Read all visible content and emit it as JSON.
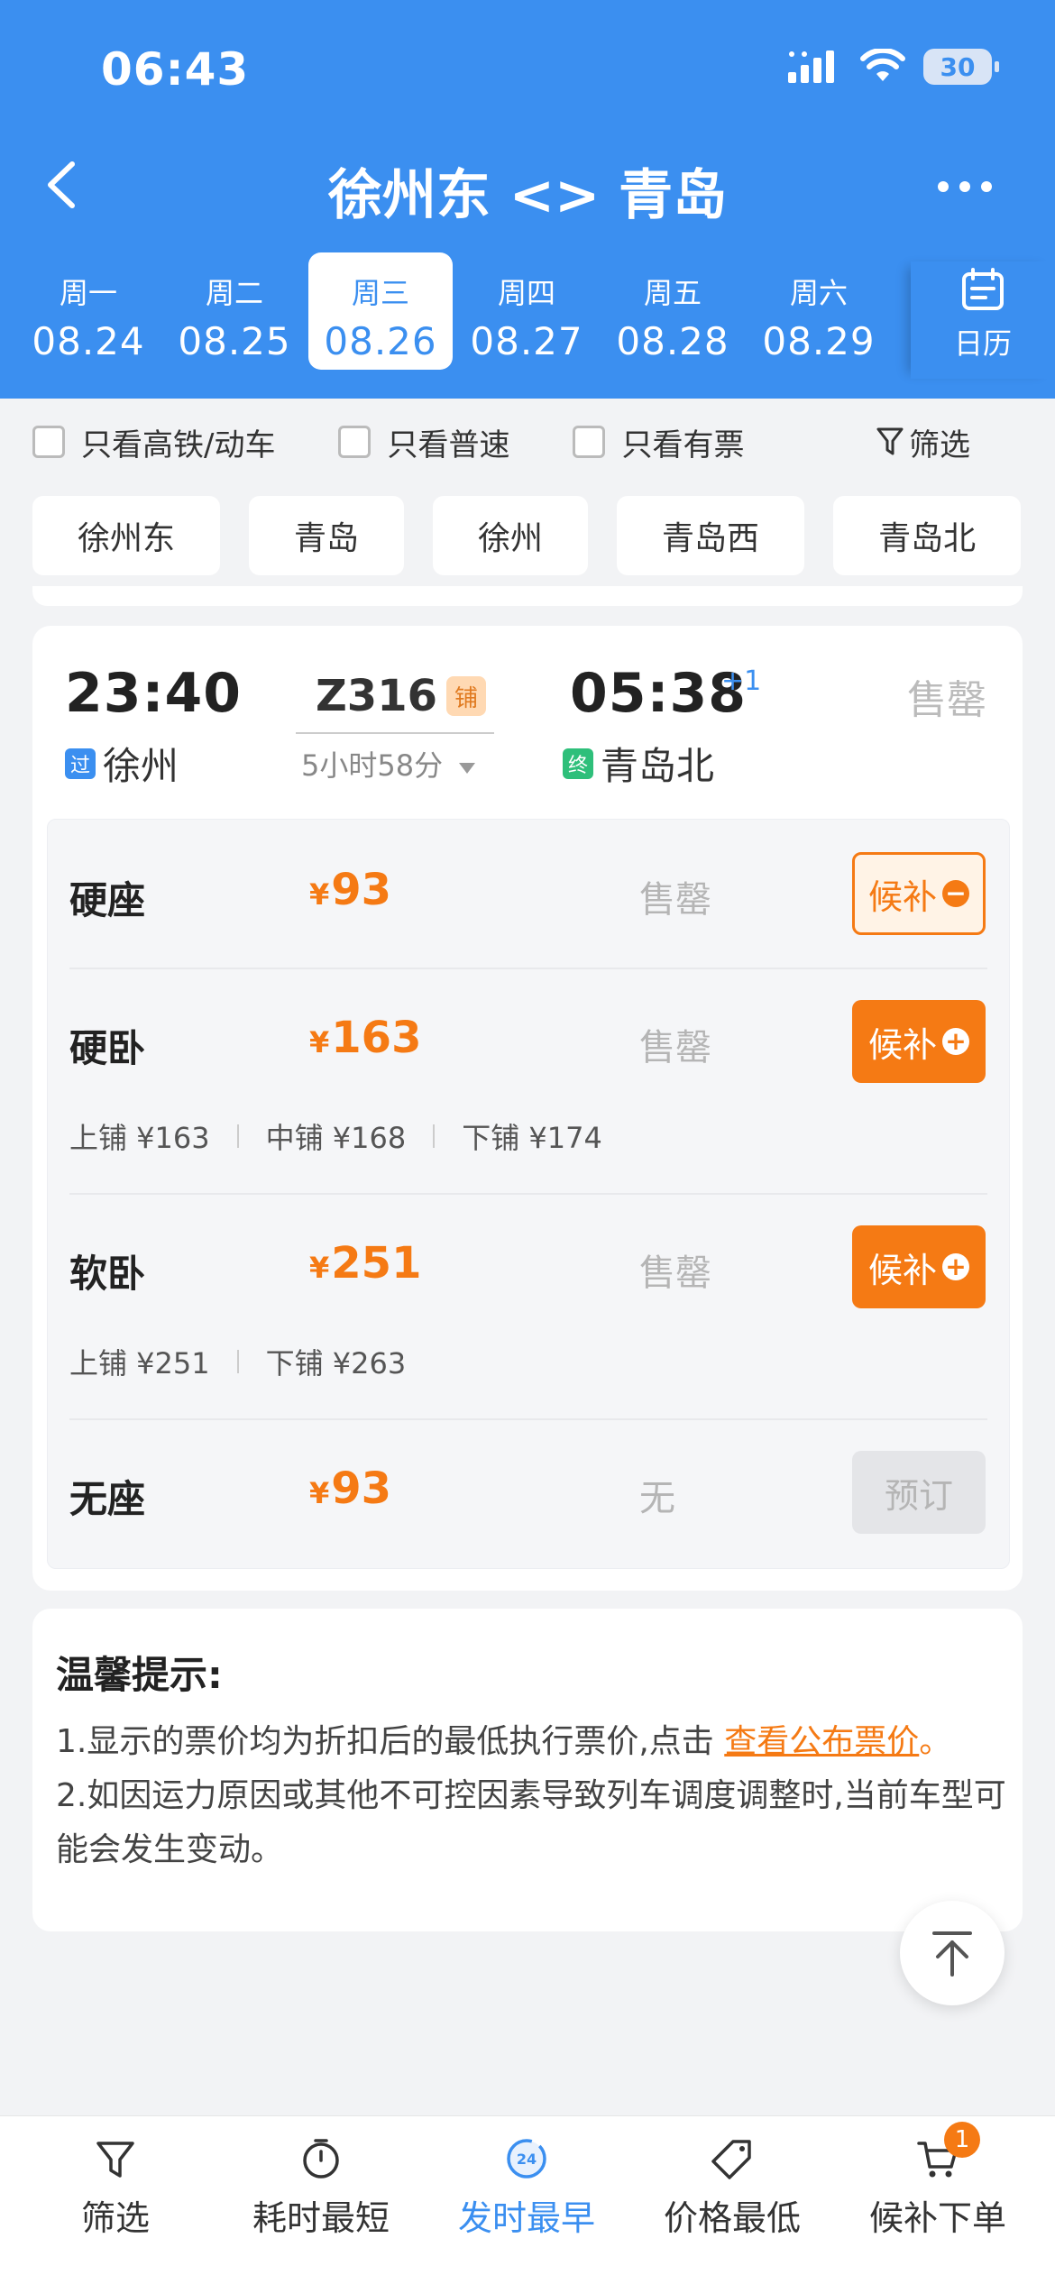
{
  "status_bar": {
    "time": "06:43",
    "battery": "30"
  },
  "header": {
    "title": "徐州东 <> 青岛",
    "date_tabs": [
      {
        "weekday": "周一",
        "date": "08.24"
      },
      {
        "weekday": "周二",
        "date": "08.25"
      },
      {
        "weekday": "周三",
        "date": "08.26"
      },
      {
        "weekday": "周四",
        "date": "08.27"
      },
      {
        "weekday": "周五",
        "date": "08.28"
      },
      {
        "weekday": "周六",
        "date": "08.29"
      }
    ],
    "active_tab_index": 2,
    "calendar_label": "日历"
  },
  "filters": {
    "high_speed": "只看高铁/动车",
    "normal": "只看普速",
    "available": "只看有票",
    "filter": "筛选"
  },
  "stations": [
    "徐州东",
    "青岛",
    "徐州",
    "青岛西",
    "青岛北"
  ],
  "train": {
    "dep_time": "23:40",
    "dep_tag": "过",
    "dep_station": "徐州",
    "train_no": "Z316",
    "berth_tag": "铺",
    "duration": "5小时58分",
    "arr_time": "05:38",
    "arr_plus": "+1",
    "arr_tag": "终",
    "arr_station": "青岛北",
    "status": "售罄",
    "seats": [
      {
        "name": "硬座",
        "currency": "¥",
        "price": "93",
        "status": "售罄",
        "button": "候补",
        "button_icon": "−"
      },
      {
        "name": "硬卧",
        "currency": "¥",
        "price": "163",
        "status": "售罄",
        "button": "候补",
        "button_icon": "+",
        "berths": [
          "上铺 ¥163",
          "中铺 ¥168",
          "下铺 ¥174"
        ]
      },
      {
        "name": "软卧",
        "currency": "¥",
        "price": "251",
        "status": "售罄",
        "button": "候补",
        "button_icon": "+",
        "berths": [
          "上铺 ¥251",
          "下铺 ¥263"
        ]
      },
      {
        "name": "无座",
        "currency": "¥",
        "price": "93",
        "status": "无",
        "button": "预订"
      }
    ]
  },
  "tips": {
    "title": "温馨提示:",
    "line1_prefix": "1.显示的票价均为折扣后的最低执行票价,点击 ",
    "line1_link": "查看公布票价",
    "line1_suffix": "。",
    "line2": "2.如因运力原因或其他不可控因素导致列车调度调整时,当前车型可能会发生变动。"
  },
  "bottom_nav": {
    "items": [
      "筛选",
      "耗时最短",
      "发时最早",
      "价格最低",
      "候补下单"
    ],
    "active_index": 2,
    "clock_badge": "24",
    "cart_badge": "1"
  },
  "colors": {
    "brand_blue": "#3b8ff0",
    "accent_orange": "#f57a14"
  }
}
